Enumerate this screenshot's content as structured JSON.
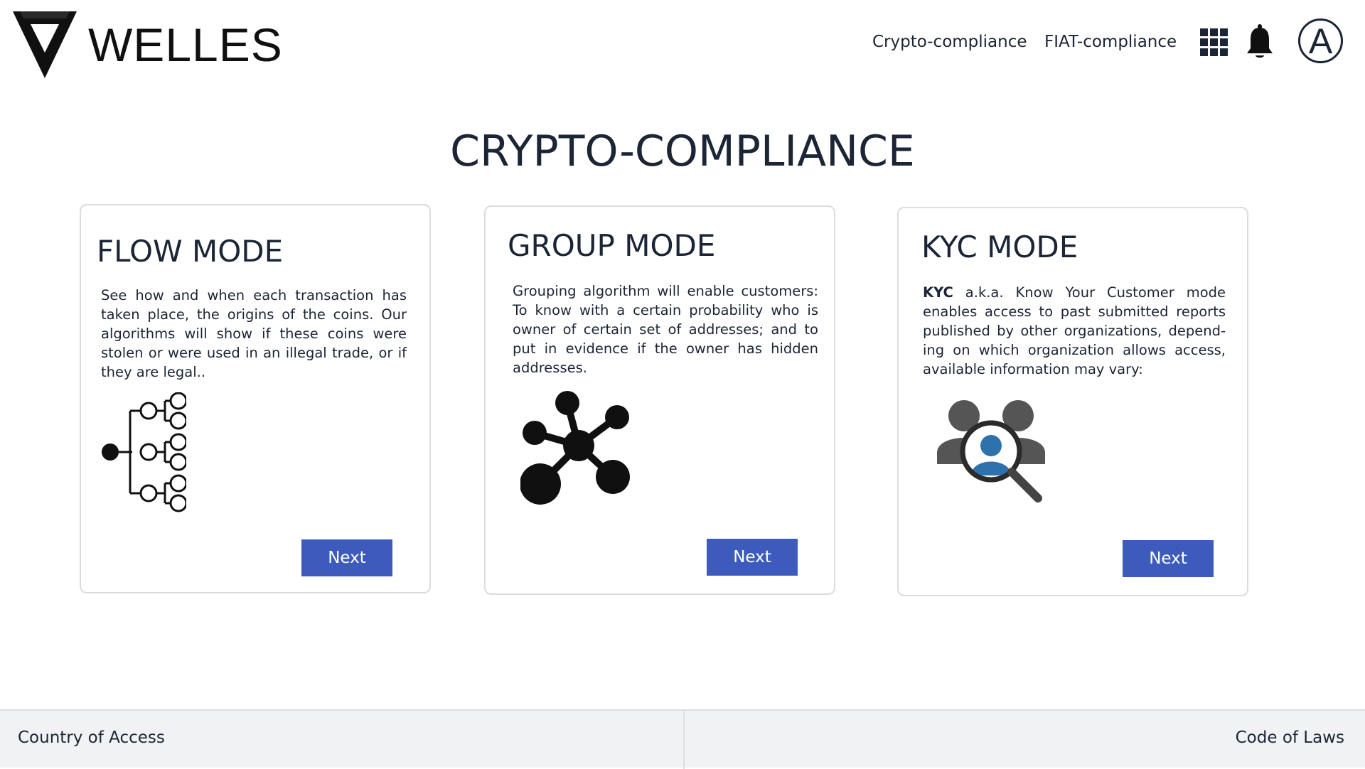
{
  "header": {
    "brand": "WELLES",
    "nav": [
      {
        "label": "Crypto-compliance"
      },
      {
        "label": "FIAT-compliance"
      }
    ],
    "icons": [
      "apps-grid-icon",
      "bell-icon"
    ],
    "avatar_initial": "A"
  },
  "page": {
    "title": "CRYPTO-COMPLIANCE"
  },
  "cards": [
    {
      "title": "FLOW MODE",
      "description": "See how and when each transaction has taken place, the origins of the coins. Our algorithms will show if these coins were stolen or were used in an illegal trade, or if they are legal..",
      "icon": "transaction-tree-icon",
      "button": "Next"
    },
    {
      "title": "GROUP MODE",
      "description": "Grouping algorithm will enable customers: To know with a certain probability who is owner of certain set of addresses; and to put in evidence if the owner has hidden addresses.",
      "icon": "network-graph-icon",
      "button": "Next"
    },
    {
      "title": "KYC MODE",
      "description_bold": "KYC",
      "description": " a.k.a. Know Your Customer mode enables access to past submitted reports published by other organizations, depend-ing on which organization allows access, available information may vary:",
      "icon": "customer-search-icon",
      "button": "Next"
    }
  ],
  "footer": {
    "left_link": "Country of Access",
    "right_link": "Code of Laws"
  },
  "colors": {
    "accent": "#3d5bbd",
    "text": "#1b2536",
    "footer_bg": "#f1f2f3",
    "card_border": "#dcdcdc",
    "kyc_blue": "#2e72ad",
    "kyc_gray": "#555555"
  }
}
